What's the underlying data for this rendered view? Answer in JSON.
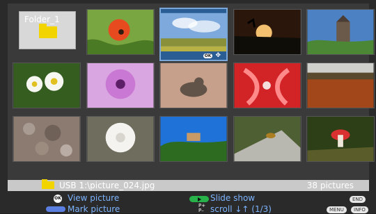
{
  "folder": {
    "label": "Folder_1",
    "icon": "folder-icon"
  },
  "tiles": [
    {
      "name": "poppy"
    },
    {
      "name": "landscape-sky"
    },
    {
      "name": "sunset"
    },
    {
      "name": "castle"
    },
    {
      "name": "daisies"
    },
    {
      "name": "purple-flower"
    },
    {
      "name": "seal"
    },
    {
      "name": "red-lily"
    },
    {
      "name": "field"
    },
    {
      "name": "stones"
    },
    {
      "name": "dandelion"
    },
    {
      "name": "village"
    },
    {
      "name": "bee"
    },
    {
      "name": "mushroom"
    }
  ],
  "status": {
    "path": "USB 1:\\picture_024.jpg",
    "count": "38 pictures"
  },
  "footer": {
    "view_picture": "View picture",
    "mark_picture": "Mark picture",
    "slide_show": "Slide show",
    "scroll": "scroll ↓↑ (1/3)",
    "ok": "OK",
    "end": "END",
    "menu": "MENU",
    "info": "INFO",
    "p_plus": "P+",
    "p_minus": "P–"
  },
  "colors": {
    "accent_blue": "#2b5d95",
    "link_blue": "#7db4ff",
    "folder_yellow": "#f1d400",
    "green_button": "#27b34a",
    "blue_button": "#5a7fe0"
  }
}
